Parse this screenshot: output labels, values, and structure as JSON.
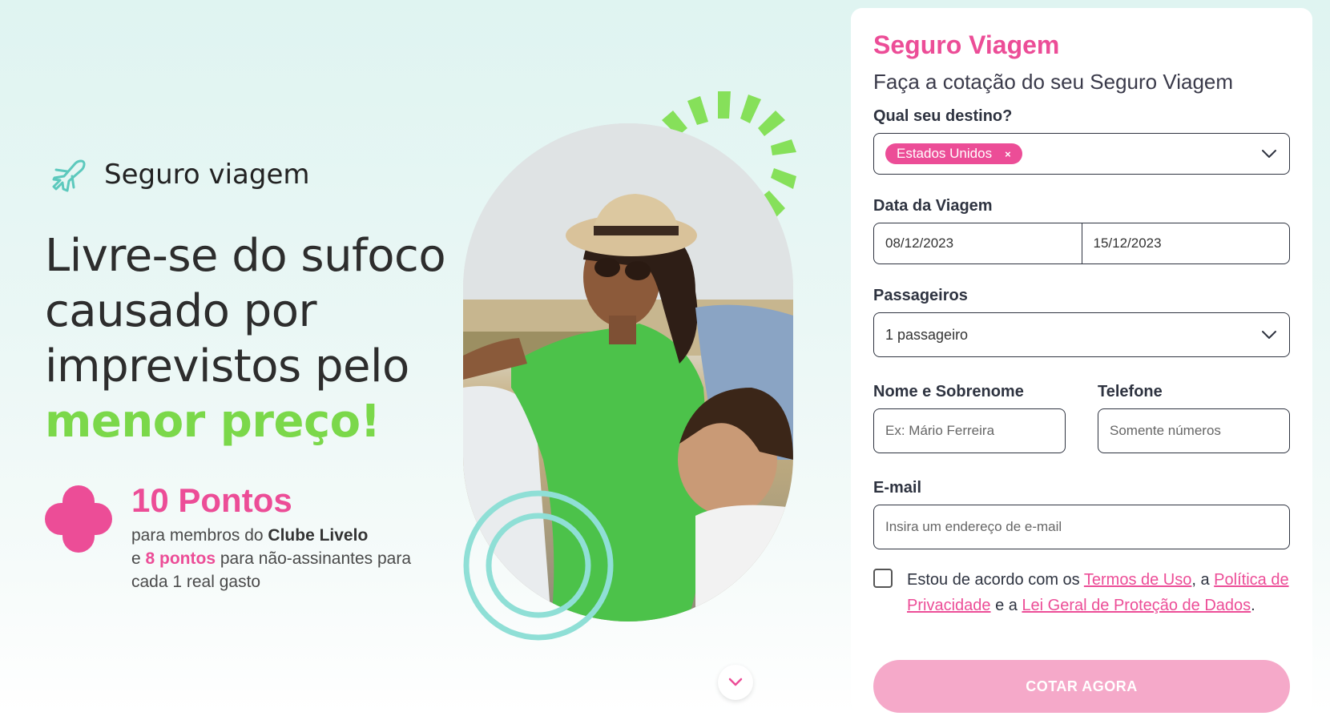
{
  "hero": {
    "brand_label": "Seguro viagem",
    "headline_1": "Livre-se do sufoco",
    "headline_2": "causado por",
    "headline_3": "imprevistos pelo",
    "headline_accent": "menor preço!",
    "points_title": "10 Pontos",
    "points_line_1a": "para membros do ",
    "points_line_1b": "Clube Livelo",
    "points_line_2a": "e ",
    "points_line_2b": "8 pontos",
    "points_line_2c": " para não-assinantes para",
    "points_line_3": "cada 1 real gasto"
  },
  "form": {
    "title": "Seguro Viagem",
    "subtitle": "Faça a cotação do seu Seguro Viagem",
    "destination_label": "Qual seu destino?",
    "destination_tag": "Estados Unidos",
    "destination_tag_remove": "×",
    "date_label": "Data da Viagem",
    "date_start": "08/12/2023",
    "date_end": "15/12/2023",
    "passengers_label": "Passageiros",
    "passengers_value": "1 passageiro",
    "name_label": "Nome e Sobrenome",
    "name_placeholder": "Ex: Mário Ferreira",
    "phone_label": "Telefone",
    "phone_placeholder": "Somente números",
    "email_label": "E-mail",
    "email_placeholder": "Insira um endereço de e-mail",
    "consent_prefix": "Estou de acordo com os ",
    "consent_terms": "Termos de Uso",
    "consent_mid": ", a ",
    "consent_privacy": "Política de Privacidade",
    "consent_and": " e a ",
    "consent_lgpd": "Lei Geral de Proteção de Dados",
    "consent_end": ".",
    "submit_label": "COTAR AGORA"
  },
  "colors": {
    "accent_pink": "#ec4d97",
    "accent_green": "#7bd84a",
    "ring_teal": "#8fdfd6",
    "button_disabled": "#f5a9c9"
  },
  "icons": {
    "brand": "airplane-icon",
    "scroll": "chevron-down-icon"
  }
}
